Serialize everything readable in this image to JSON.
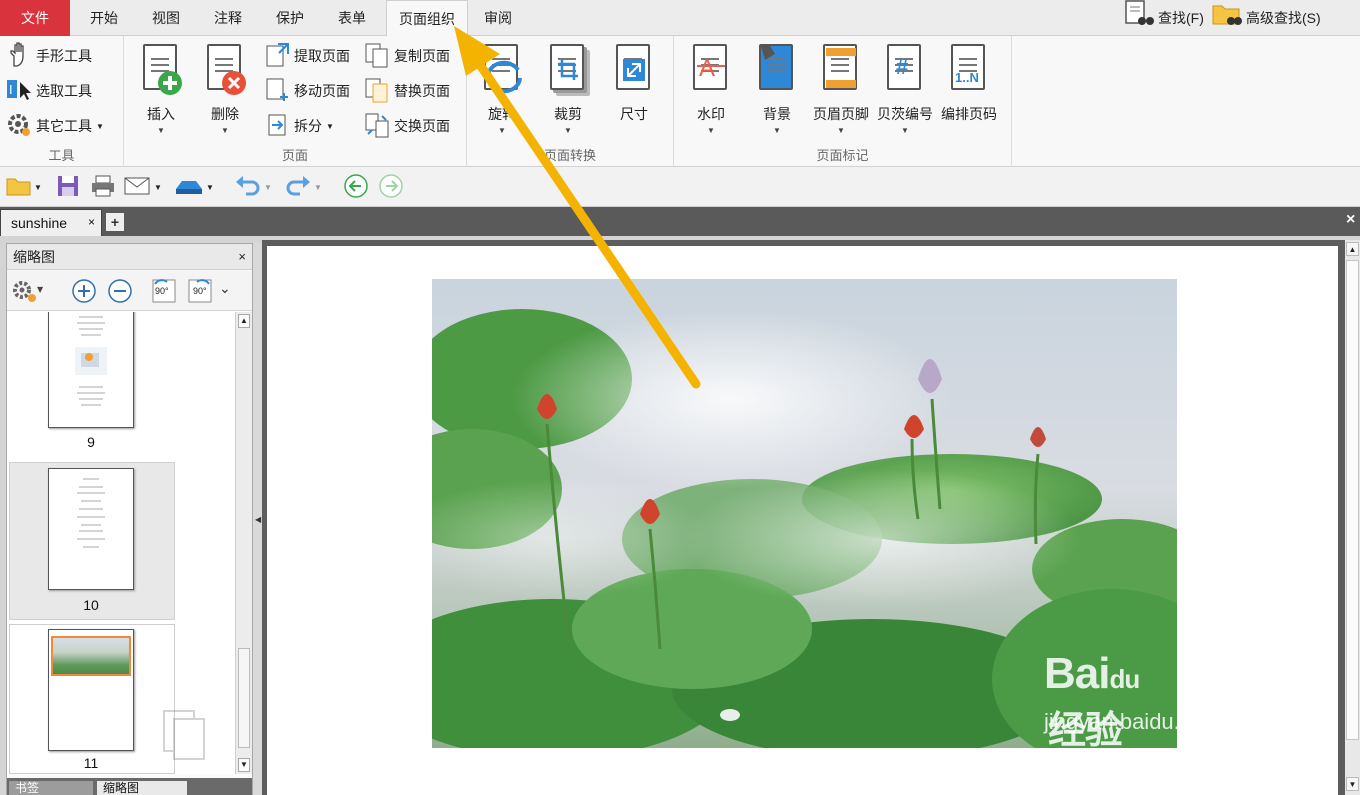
{
  "menu": {
    "file": "文件",
    "tabs": [
      "开始",
      "视图",
      "注释",
      "保护",
      "表单",
      "页面组织",
      "审阅"
    ],
    "find": "查找(F)",
    "advanced_find": "高级查找(S)"
  },
  "ribbon": {
    "tools_group": {
      "label": "工具",
      "hand": "手形工具",
      "select": "选取工具",
      "other": "其它工具"
    },
    "page_group": {
      "label": "页面",
      "insert": "插入",
      "delete": "删除",
      "extract": "提取页面",
      "move": "移动页面",
      "split": "拆分",
      "copy": "复制页面",
      "replace": "替换页面",
      "swap": "交换页面"
    },
    "transform_group": {
      "label": "页面转换",
      "rotate": "旋转",
      "crop": "裁剪",
      "size": "尺寸"
    },
    "marks_group": {
      "label": "页面标记",
      "watermark": "水印",
      "background": "背景",
      "header_footer": "页眉页脚",
      "bates": "贝茨编号",
      "page_number": "编排页码",
      "page_number_icon": "1..N"
    }
  },
  "doc_tab": {
    "name": "sunshine"
  },
  "thumbnail_panel": {
    "title": "缩略图",
    "rotate_left_label": "90°",
    "rotate_right_label": "90°",
    "pages": [
      {
        "number": "9"
      },
      {
        "number": "10"
      },
      {
        "number": "11"
      }
    ],
    "bottom_tabs": [
      "书签",
      "缩略图"
    ]
  },
  "watermark": {
    "brand": "Bai",
    "brand_du": "du",
    "cn": "经验",
    "url": "jingyan.baidu.com"
  },
  "colors": {
    "file_menu_bg": "#d9343e",
    "arrow": "#f5b301",
    "accent_blue": "#2e88d8"
  }
}
